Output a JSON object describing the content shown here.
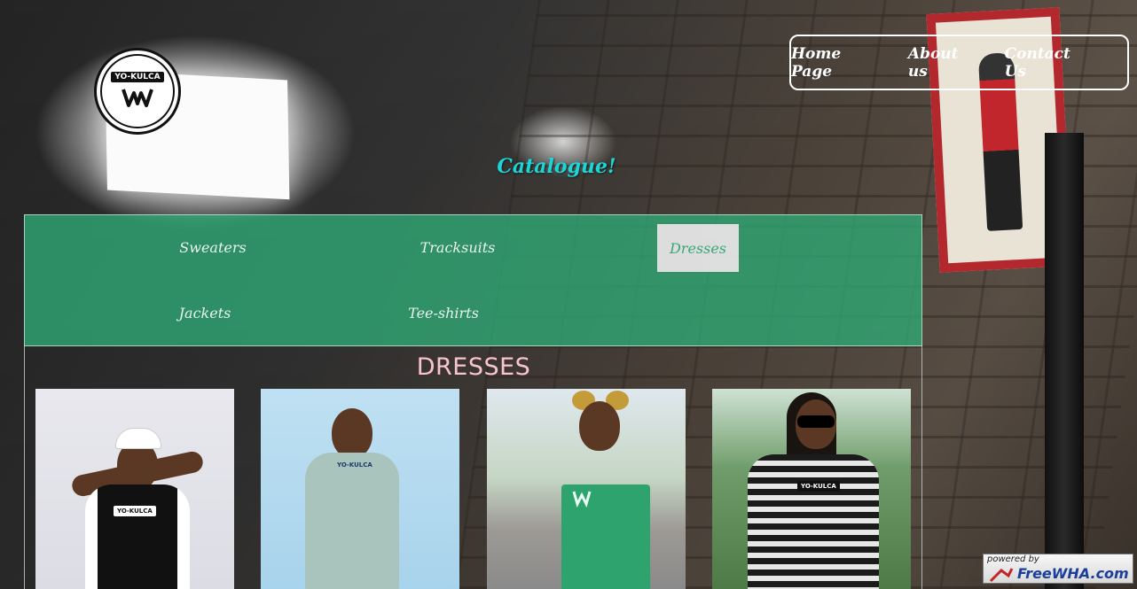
{
  "logo": {
    "text": "YO-KULCA",
    "mark": "M"
  },
  "nav": {
    "items": [
      {
        "label": "Home Page"
      },
      {
        "label": "About us"
      },
      {
        "label": "Contact Us"
      }
    ]
  },
  "catalogue": {
    "title": "Catalogue!"
  },
  "tabs": [
    {
      "label": "Sweaters",
      "active": false
    },
    {
      "label": "Tracksuits",
      "active": false
    },
    {
      "label": "Dresses",
      "active": true
    },
    {
      "label": "Jackets",
      "active": false
    },
    {
      "label": "Tee-shirts",
      "active": false
    }
  ],
  "section": {
    "heading": "DRESSES"
  },
  "products": [
    {
      "name": "black-white-dress-photo",
      "tag": "YO-KULCA"
    },
    {
      "name": "mint-bodycon-dress-photo",
      "tag": "YO-KULCA"
    },
    {
      "name": "green-tube-dress-photo",
      "tag": ""
    },
    {
      "name": "striped-tshirt-dress-photo",
      "tag": "YO-KULCA"
    }
  ],
  "badge": {
    "line1": "powered by",
    "line2": "FreeWHA.com"
  },
  "colors": {
    "tab_panel": "#30aa76",
    "title_accent": "#1ad6d6",
    "heading_pink": "#f1c7cf"
  }
}
